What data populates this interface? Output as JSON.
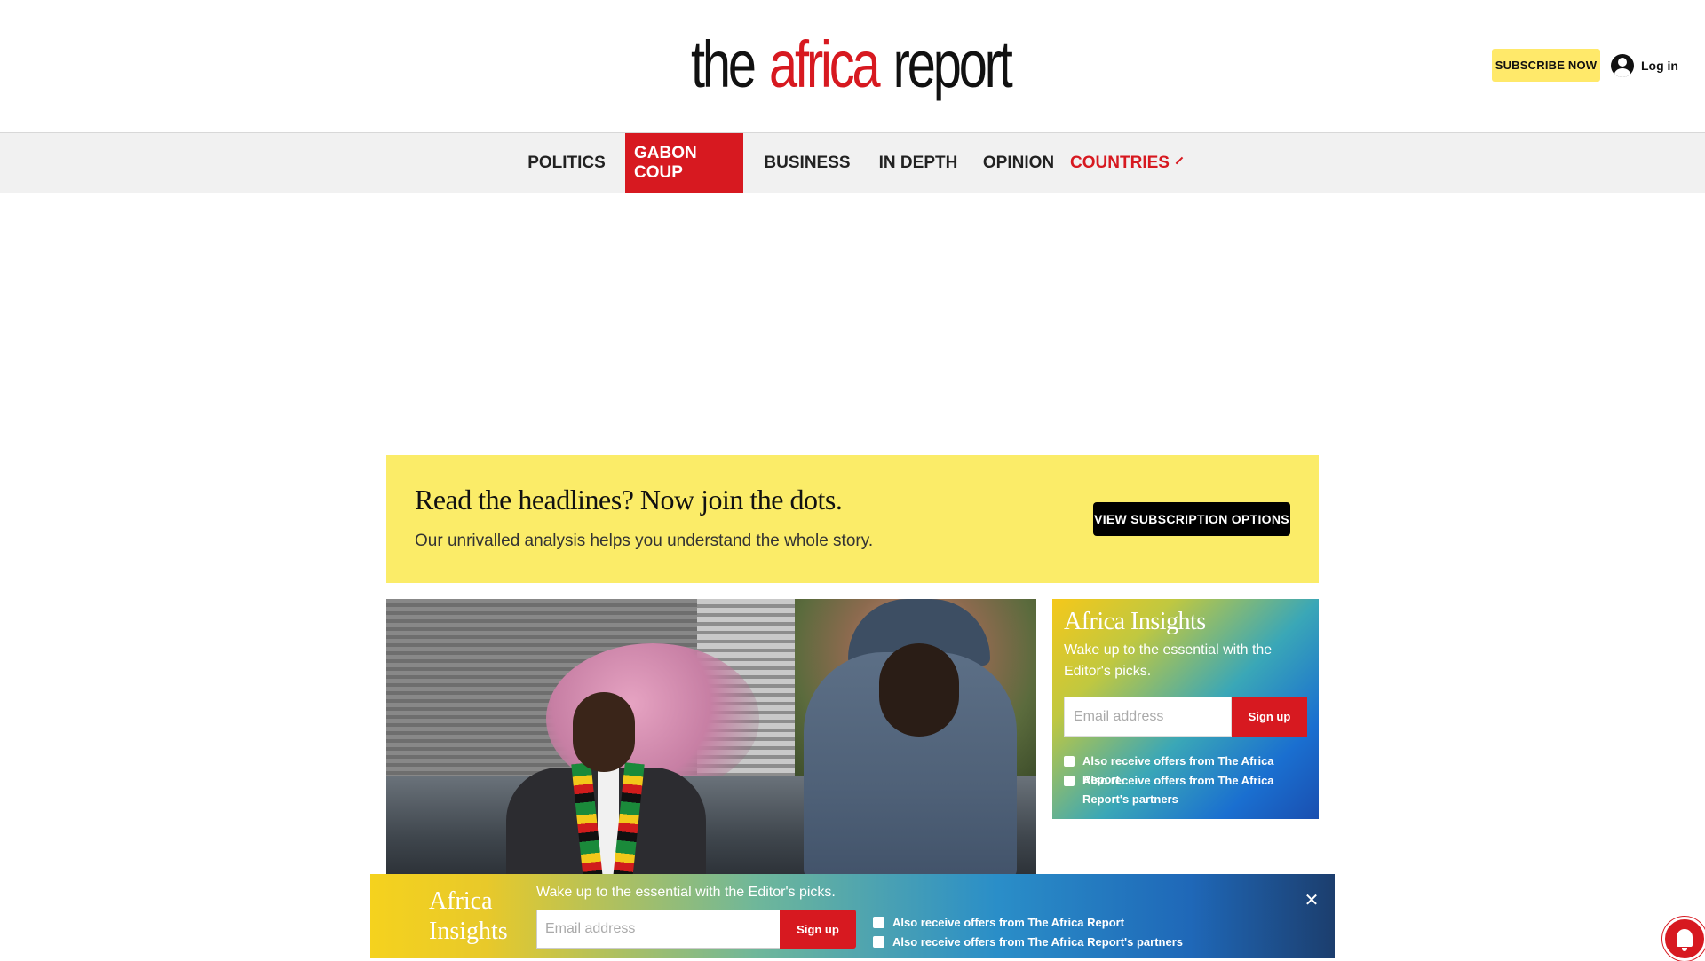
{
  "header": {
    "logo": {
      "the": "the",
      "africa": "africa",
      "report": "report"
    },
    "subscribe_label": "Subscribe now",
    "login_label": "Log in"
  },
  "nav": {
    "items": [
      {
        "label": "POLITICS"
      },
      {
        "label": "GABON COUP"
      },
      {
        "label": "BUSINESS"
      },
      {
        "label": "IN DEPTH"
      },
      {
        "label": "OPINION"
      },
      {
        "label": "COUNTRIES"
      }
    ],
    "active_color": "#d71920"
  },
  "promo": {
    "title": "Read the headlines? Now join the dots.",
    "subtitle": "Our unrivalled analysis helps you understand the whole story.",
    "button_label": "VIEW SUBSCRIPTION OPTIONS",
    "background": "#fbec68"
  },
  "insights": {
    "title": "Africa Insights",
    "subtitle": "Wake up to the essential with the Editor's picks.",
    "email_placeholder": "Email address",
    "signup_label": "Sign up",
    "check1": "Also receive offers from The Africa Report",
    "check2": "Also receive offers from The Africa Report's partners"
  },
  "sticky": {
    "title": "Africa Insights",
    "subtitle": "Wake up to the essential with the Editor's picks.",
    "email_placeholder": "Email address",
    "signup_label": "Sign up",
    "check1": "Also receive offers from The Africa Report",
    "check2": "Also receive offers from The Africa Report's partners",
    "close_icon": "close-icon"
  },
  "colors": {
    "brand_red": "#d71920",
    "brand_yellow": "#ffe96a"
  }
}
